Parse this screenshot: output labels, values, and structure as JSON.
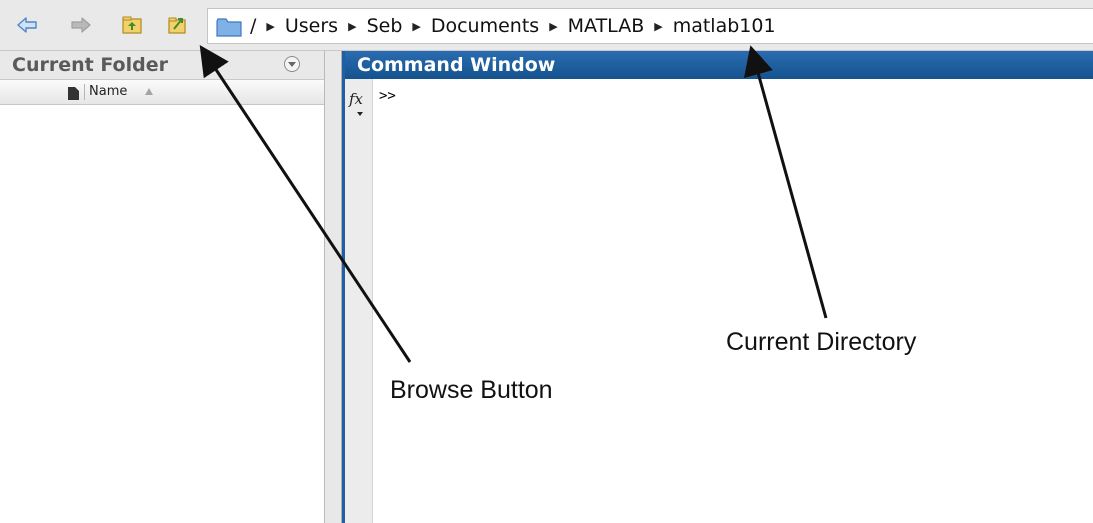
{
  "toolbar": {
    "back_icon": "back-arrow-icon",
    "forward_icon": "forward-arrow-icon",
    "up_icon": "up-folder-icon",
    "browse_icon": "browse-folder-icon",
    "path_root": "/",
    "path": [
      "Users",
      "Seb",
      "Documents",
      "MATLAB",
      "matlab101"
    ]
  },
  "current_folder": {
    "title": "Current Folder",
    "column_name": "Name"
  },
  "command_window": {
    "title": "Command Window",
    "fx_label": "fx",
    "prompt": ">>"
  },
  "annotations": {
    "browse_button": "Browse Button",
    "current_directory": "Current Directory"
  },
  "colors": {
    "command_header": "#1f5fa3",
    "toolbar_bg": "#e9e9e9",
    "icon_blue": "#6fa3dc",
    "icon_green": "#6fb24a",
    "folder_yellow": "#f2c744"
  }
}
